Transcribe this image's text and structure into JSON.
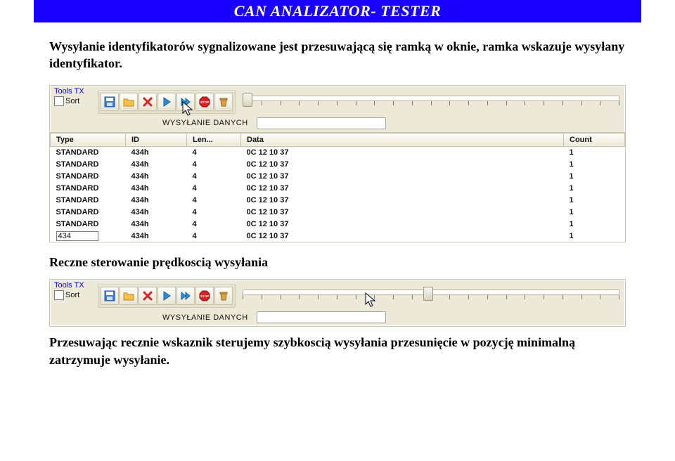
{
  "header": {
    "title": "CAN ANALIZATOR- TESTER"
  },
  "para1": "Wysyłanie identyfikatorów sygnalizowane jest przesuwającą się  ramką  w oknie, ramka wskazuje wysyłany identyfikator.",
  "para2": "Reczne sterowanie prędkoscią wysyłania",
  "para3": "Przesuwając recznie wskaznik sterujemy szybkoscią wysyłania przesunięcie w pozycję minimalną zatrzymuje wysyłanie.",
  "toolsTx": {
    "label": "Tools TX",
    "sort": "Sort"
  },
  "status": {
    "label": "WYSYŁANIE DANYCH"
  },
  "table": {
    "headers": [
      "Type",
      "ID",
      "Len...",
      "Data",
      "Count"
    ],
    "rows": [
      [
        "STANDARD",
        "434h",
        "4",
        "0C 12 10 37",
        "1"
      ],
      [
        "STANDARD",
        "434h",
        "4",
        "0C 12 10 37",
        "1"
      ],
      [
        "STANDARD",
        "434h",
        "4",
        "0C 12 10 37",
        "1"
      ],
      [
        "STANDARD",
        "434h",
        "4",
        "0C 12 10 37",
        "1"
      ],
      [
        "STANDARD",
        "434h",
        "4",
        "0C 12 10 37",
        "1"
      ],
      [
        "STANDARD",
        "434h",
        "4",
        "0C 12 10 37",
        "1"
      ],
      [
        "STANDARD",
        "434h",
        "4",
        "0C 12 10 37",
        "1"
      ]
    ],
    "editingRow": {
      "value": "434",
      "rest": [
        "434h",
        "4",
        "0C 12 10 37",
        "1"
      ]
    }
  },
  "icons": {
    "save": "save-icon",
    "open": "folder-open-icon",
    "delete": "delete-icon",
    "play": "play-icon",
    "forward": "forward-icon",
    "stop": "stop-icon",
    "trash": "trash-icon"
  }
}
